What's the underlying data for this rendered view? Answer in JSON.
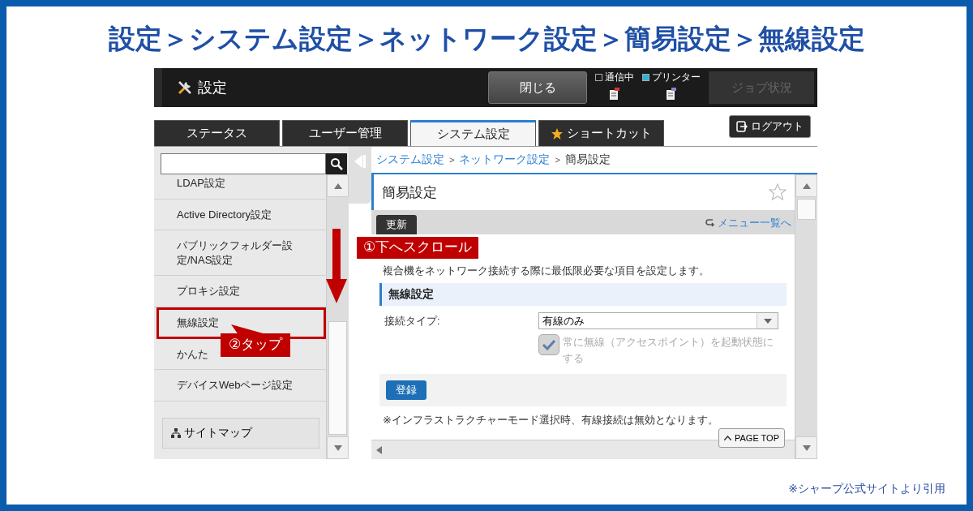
{
  "title": "設定＞システム設定＞ネットワーク設定＞簡易設定＞無線設定",
  "header": {
    "title": "設定",
    "close_button": "閉じる",
    "indicators": [
      {
        "label": "通信中",
        "on": false
      },
      {
        "label": "プリンター",
        "on": true
      }
    ],
    "job_button": {
      "label": "ジョブ状況",
      "disabled": true
    }
  },
  "tabs": [
    {
      "label": "ステータス",
      "selected": false,
      "starred": false
    },
    {
      "label": "ユーザー管理",
      "selected": false,
      "starred": false
    },
    {
      "label": "システム設定",
      "selected": true,
      "starred": false
    },
    {
      "label": "ショートカット",
      "selected": false,
      "starred": true
    }
  ],
  "logout_button": "ログアウト",
  "sidebar": {
    "items": [
      {
        "label": "LDAP設定",
        "highlighted": false
      },
      {
        "label": "Active Directory設定",
        "highlighted": false
      },
      {
        "label": "パブリックフォルダー設定/NAS設定",
        "highlighted": false
      },
      {
        "label": "プロキシ設定",
        "highlighted": false
      },
      {
        "label": "無線設定",
        "highlighted": true
      },
      {
        "label": "かんた",
        "highlighted": false
      },
      {
        "label": "デバイスWebページ設定",
        "highlighted": false
      }
    ],
    "sitemap": "サイトマップ"
  },
  "breadcrumb": [
    {
      "label": "システム設定",
      "link": true
    },
    {
      "separator": ">",
      "label": "ネットワーク設定",
      "link": true
    },
    {
      "separator": ">",
      "label": "簡易設定",
      "link": false
    }
  ],
  "page": {
    "title": "簡易設定",
    "favorite": false,
    "refresh_button": "更新",
    "menu_link": "メニュー一覧へ",
    "description": "複合機をネットワーク接続する際に最低限必要な項目を設定します。",
    "section": "無線設定",
    "field": {
      "label": "接続タイプ:",
      "value": "有線のみ"
    },
    "checkbox": {
      "label": "常に無線（アクセスポイント）を起動状態にする",
      "checked": true,
      "disabled": true
    },
    "register_button": "登録",
    "note": "※インフラストラクチャーモード選択時、有線接続は無効となります。",
    "page_top": "PAGE TOP"
  },
  "callouts": [
    {
      "kind": "scroll",
      "text": "①下へスクロール"
    },
    {
      "kind": "tap",
      "text": "②タップ"
    }
  ],
  "source_note": "※シャープ公式サイトより引用"
}
